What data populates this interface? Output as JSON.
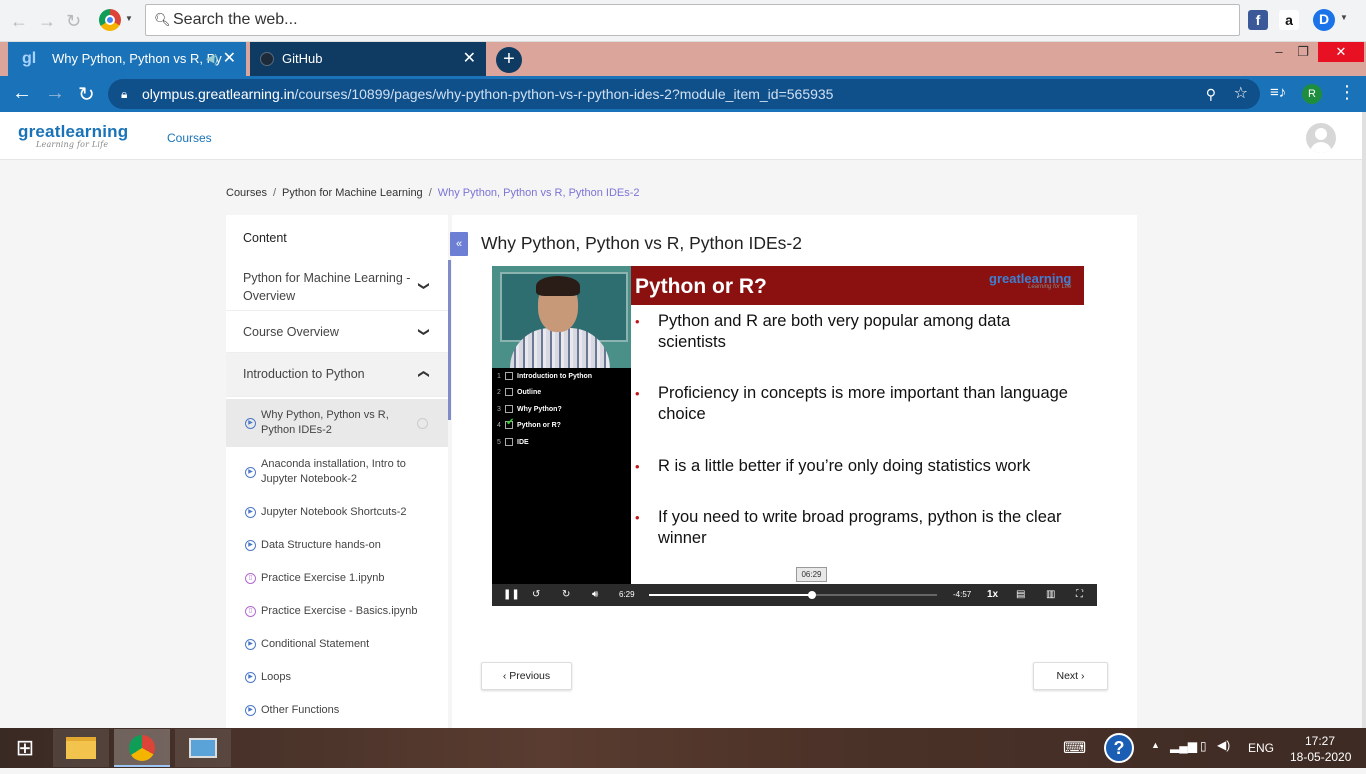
{
  "outer_toolbar": {
    "search_placeholder": "Search the web...",
    "back_icon": "arrow-left-icon",
    "forward_icon": "arrow-right-icon",
    "reload_icon": "reload-icon"
  },
  "tabs": [
    {
      "label": "Why Python, Python vs R, Py",
      "active": true
    },
    {
      "label": "GitHub",
      "active": false
    }
  ],
  "new_tab_label": "+",
  "window_controls": {
    "minimize": "‒",
    "restore": "❐",
    "close": "✕"
  },
  "address": {
    "url_domain": "olympus.greatlearning.in",
    "url_path": "/courses/10899/pages/why-python-python-vs-r-python-ides-2?module_item_id=565935",
    "profile_letter": "R"
  },
  "header": {
    "logo_text": "greatlearning",
    "logo_tagline": "Learning for Life",
    "nav_courses": "Courses"
  },
  "breadcrumb": {
    "item1": "Courses",
    "item2": "Python for Machine Learning",
    "current": "Why Python, Python vs R, Python IDEs-2",
    "sep": "/"
  },
  "sidebar": {
    "heading": "Content",
    "sections": [
      {
        "label": "Python for Machine Learning - Overview",
        "expanded": false
      },
      {
        "label": "Course Overview",
        "expanded": false
      },
      {
        "label": "Introduction to Python",
        "expanded": true
      }
    ],
    "items": [
      {
        "label": "Why Python, Python vs R, Python IDEs-2",
        "type": "video",
        "active": true
      },
      {
        "label": "Anaconda installation, Intro to Jupyter Notebook-2",
        "type": "video"
      },
      {
        "label": "Jupyter Notebook Shortcuts-2",
        "type": "video"
      },
      {
        "label": "Data Structure hands-on",
        "type": "video"
      },
      {
        "label": "Practice Exercise 1.ipynb",
        "type": "notebook"
      },
      {
        "label": "Practice Exercise - Basics.ipynb",
        "type": "notebook"
      },
      {
        "label": "Conditional Statement",
        "type": "video"
      },
      {
        "label": "Loops",
        "type": "video"
      },
      {
        "label": "Other Functions",
        "type": "video"
      }
    ]
  },
  "main": {
    "title": "Why Python, Python vs R, Python IDEs-2",
    "collapse_label": "«"
  },
  "video": {
    "toc": [
      {
        "num": "1",
        "label": "Introduction to Python",
        "checked": false
      },
      {
        "num": "2",
        "label": "Outline",
        "checked": false
      },
      {
        "num": "3",
        "label": "Why Python?",
        "checked": false
      },
      {
        "num": "4",
        "label": "Python or R?",
        "checked": true
      },
      {
        "num": "5",
        "label": "IDE",
        "checked": false
      }
    ],
    "slide_title": "Python or R?",
    "slide_logo": "greatlearning",
    "slide_logo_tagline": "Learning for Life",
    "bullets": [
      "Python and R are both very popular among data scientists",
      "Proficiency in concepts is more important than language choice",
      "R is a little better if you’re only doing statistics work",
      "If you need to write broad programs, python is the clear winner"
    ],
    "current_time": "6:29",
    "remaining_time": "-4:57",
    "speed": "1x",
    "tooltip_time": "06:29",
    "progress_fraction": 0.567
  },
  "pager": {
    "previous_label": "Previous",
    "next_label": "Next"
  },
  "taskbar": {
    "language": "ENG",
    "time": "17:27",
    "date": "18-05-2020"
  }
}
